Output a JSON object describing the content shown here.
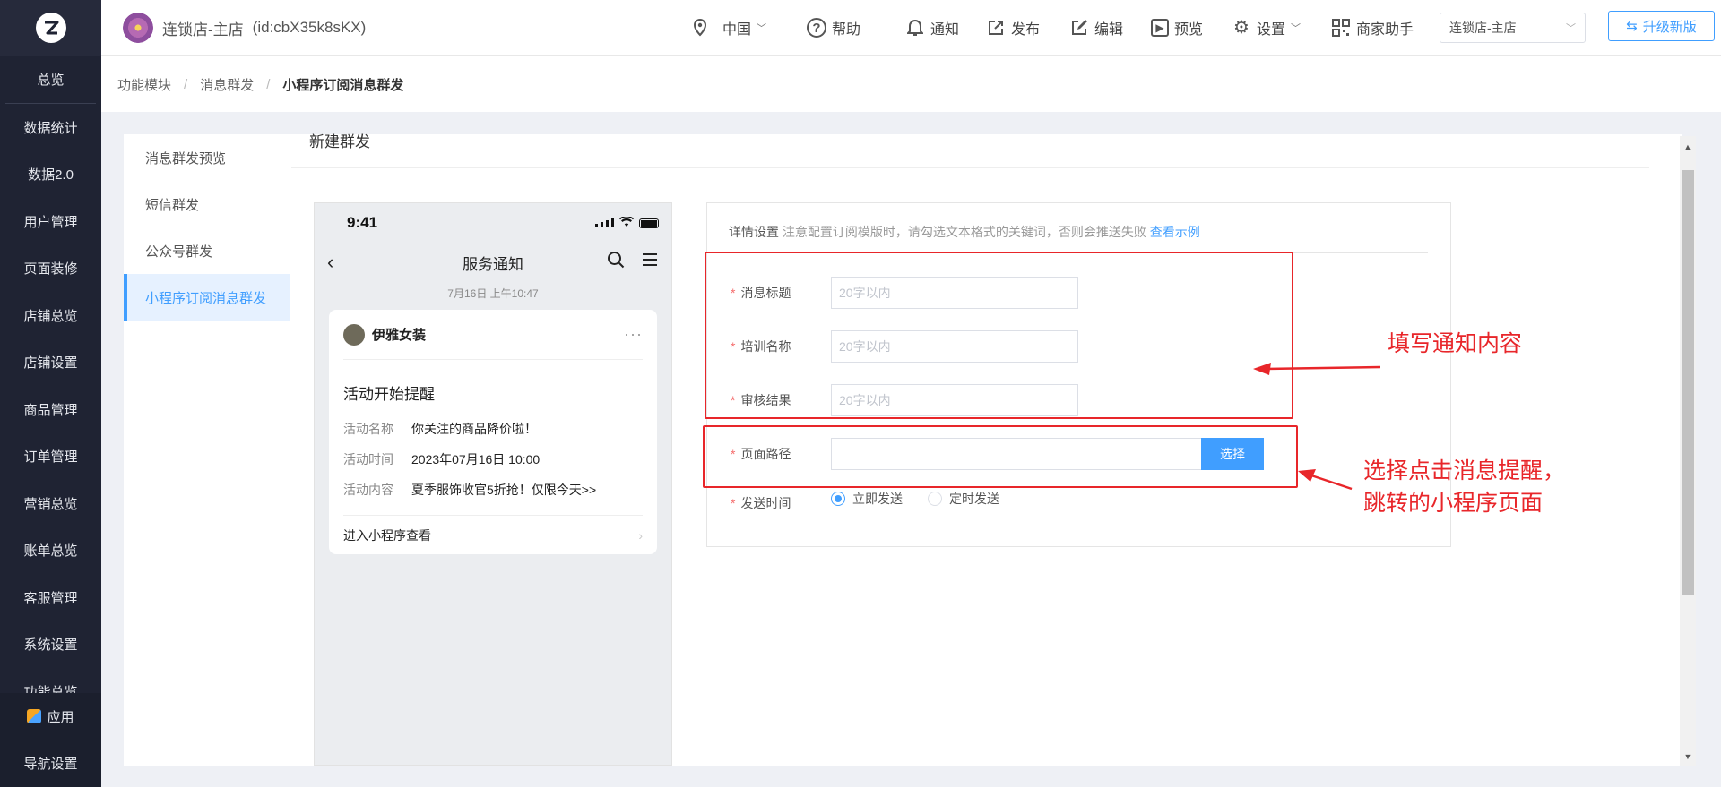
{
  "sidebar": {
    "items": [
      "总览",
      "数据统计",
      "数据2.0",
      "用户管理",
      "页面装修",
      "店铺总览",
      "店铺设置",
      "商品管理",
      "订单管理",
      "营销总览",
      "账单总览",
      "客服管理",
      "系统设置",
      "功能总览"
    ],
    "apps": "应用",
    "nav_settings": "导航设置"
  },
  "topbar": {
    "shop_name": "连锁店-主店",
    "shop_id": "(id:cbX35k8sKX)",
    "region": "中国",
    "help": "帮助",
    "notice": "通知",
    "publish": "发布",
    "edit": "编辑",
    "preview": "预览",
    "settings": "设置",
    "assistant": "商家助手",
    "store_select": "连锁店-主店",
    "upgrade": "升级新版"
  },
  "breadcrumb": [
    "功能模块",
    "消息群发",
    "小程序订阅消息群发"
  ],
  "subnav": [
    "消息群发预览",
    "短信群发",
    "公众号群发",
    "小程序订阅消息群发"
  ],
  "panel_title": "新建群发",
  "phone": {
    "clock": "9:41",
    "title": "服务通知",
    "timestamp": "7月16日 上午10:47",
    "sender": "伊雅女装",
    "msg_title": "活动开始提醒",
    "rows": [
      {
        "k": "活动名称",
        "v": "你关注的商品降价啦！"
      },
      {
        "k": "活动时间",
        "v": "2023年07月16日 10:00"
      },
      {
        "k": "活动内容",
        "v": "夏季服饰收官5折抢！仅限今天>>"
      }
    ],
    "footer": "进入小程序查看"
  },
  "form": {
    "tip_label": "详情设置",
    "tip_text": "注意配置订阅模版时，请勾选文本格式的关键词，否则会推送失败",
    "tip_link": "查看示例",
    "fields": [
      {
        "label": "消息标题",
        "placeholder": "20字以内"
      },
      {
        "label": "培训名称",
        "placeholder": "20字以内"
      },
      {
        "label": "审核结果",
        "placeholder": "20字以内"
      }
    ],
    "path_label": "页面路径",
    "path_button": "选择",
    "send_label": "发送时间",
    "send_options": [
      "立即发送",
      "定时发送"
    ],
    "send_selected": "立即发送"
  },
  "annotations": {
    "fill": "填写通知内容",
    "choose_line1": "选择点击消息提醒，",
    "choose_line2": "跳转的小程序页面"
  },
  "colors": {
    "accent": "#409eff",
    "annotation": "#e8262a",
    "sidebar": "#1f2333"
  }
}
